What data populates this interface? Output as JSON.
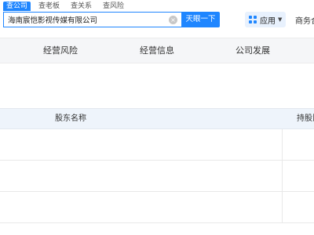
{
  "search": {
    "tabs": [
      "查公司",
      "查老板",
      "查关系",
      "查风险"
    ],
    "active_tab": 0,
    "query": "海南宸恺影视传媒有限公司",
    "clear_icon": "close-circle-icon",
    "button_label": "天眼一下"
  },
  "header": {
    "apps_label": "应用",
    "apps_icon": "grid-icon",
    "caret_icon": "caret-down-icon",
    "business_link": "商务合"
  },
  "nav": {
    "tabs": [
      "经营风险",
      "经营信息",
      "公司发展"
    ]
  },
  "table": {
    "columns": [
      "股东名称",
      "持股比"
    ],
    "rows": [
      {
        "name": "",
        "ratio": ""
      },
      {
        "name": "",
        "ratio": ""
      },
      {
        "name": "",
        "ratio": ""
      }
    ]
  },
  "colors": {
    "accent": "#1f86ff",
    "header_bg": "#eef4fb",
    "subnav_bg": "#f5f6f8"
  }
}
